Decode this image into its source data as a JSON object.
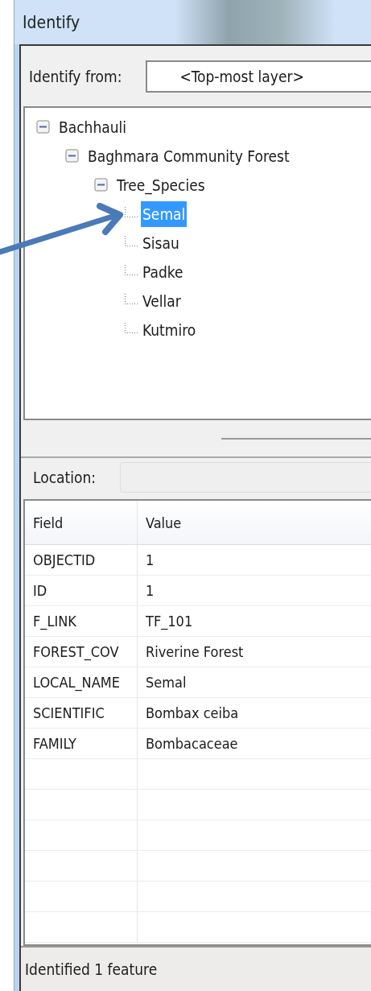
{
  "window": {
    "title": "Identify"
  },
  "identify_from": {
    "label": "Identify from:",
    "value": "<Top-most layer>"
  },
  "tree": [
    {
      "label": "Bachhauli",
      "expanded": true,
      "selected": false,
      "children": [
        {
          "label": "Baghmara Community Forest",
          "expanded": true,
          "selected": false,
          "children": [
            {
              "label": "Tree_Species",
              "expanded": true,
              "selected": false,
              "children": [
                {
                  "label": "Semal",
                  "selected": true
                },
                {
                  "label": "Sisau",
                  "selected": false
                },
                {
                  "label": "Padke",
                  "selected": false
                },
                {
                  "label": "Vellar",
                  "selected": false
                },
                {
                  "label": "Kutmiro",
                  "selected": false
                }
              ]
            }
          ]
        }
      ]
    }
  ],
  "location": {
    "label": "Location:"
  },
  "table": {
    "columns": [
      "Field",
      "Value"
    ],
    "rows": [
      [
        "OBJECTID",
        "1"
      ],
      [
        "ID",
        "1"
      ],
      [
        "F_LINK",
        "TF_101"
      ],
      [
        "FOREST_COV",
        "Riverine Forest"
      ],
      [
        "LOCAL_NAME",
        "Semal"
      ],
      [
        "SCIENTIFIC",
        "Bombax ceiba"
      ],
      [
        "FAMILY",
        "Bombacaceae"
      ]
    ]
  },
  "status_bar": "Identified 1 feature"
}
